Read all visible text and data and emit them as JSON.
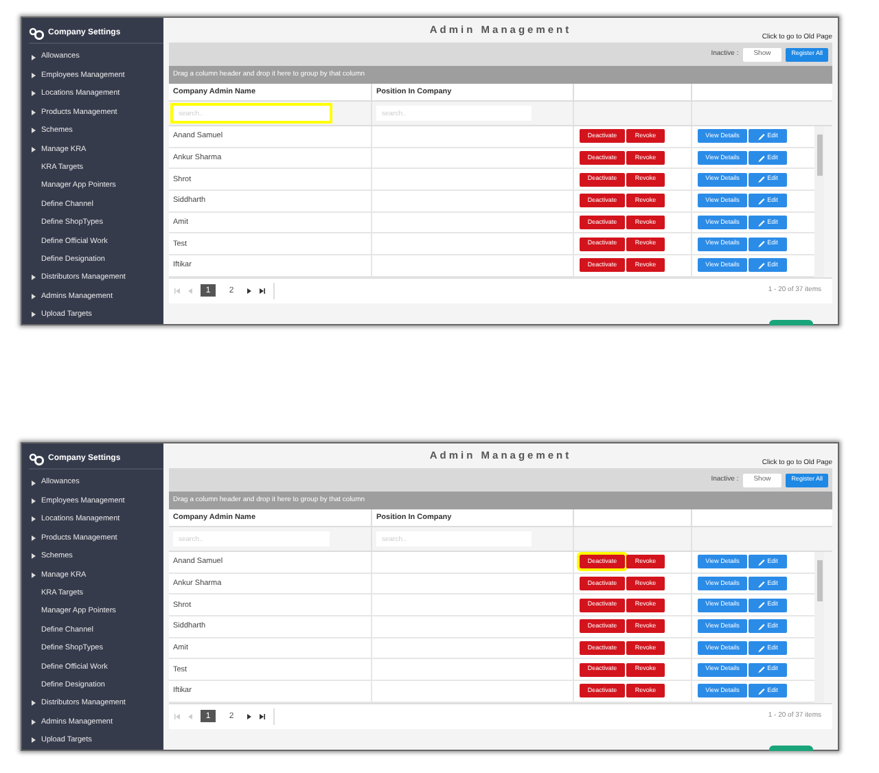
{
  "panels": [
    {
      "sidebar": {
        "title": "Company Settings",
        "items": [
          {
            "label": "Allowances",
            "arrow": true
          },
          {
            "label": "Employees Management",
            "arrow": true
          },
          {
            "label": "Locations Management",
            "arrow": true
          },
          {
            "label": "Products Management",
            "arrow": true
          },
          {
            "label": "Schemes",
            "arrow": true
          },
          {
            "label": "Manage KRA",
            "arrow": true
          },
          {
            "label": "KRA Targets",
            "arrow": false
          },
          {
            "label": "Manager App Pointers",
            "arrow": false
          },
          {
            "label": "Define Channel",
            "arrow": false
          },
          {
            "label": "Define ShopTypes",
            "arrow": false
          },
          {
            "label": "Define Official Work",
            "arrow": false
          },
          {
            "label": "Define Designation",
            "arrow": false
          },
          {
            "label": "Distributors Management",
            "arrow": true
          },
          {
            "label": "Admins Management",
            "arrow": true
          },
          {
            "label": "Upload Targets",
            "arrow": true
          }
        ]
      },
      "title": "Admin Management",
      "old_page_link": "Click to go to Old Page",
      "inactive_label": "Inactive :",
      "show_toggle": "Show",
      "register_all": "Register All",
      "group_hint": "Drag a column header and drop it here to group by that column",
      "columns": [
        {
          "title": "Company Admin Name",
          "placeholder": "search..",
          "highlighted": true
        },
        {
          "title": "Position In Company",
          "placeholder": "search..",
          "highlighted": false
        }
      ],
      "rows": [
        {
          "name": "Anand Samuel",
          "deactivate": "Deactivate",
          "revoke": "Revoke",
          "view": "View Details",
          "edit": "Edit",
          "highlighted": false
        },
        {
          "name": "Ankur Sharma",
          "deactivate": "Deactivate",
          "revoke": "Revoke",
          "view": "View Details",
          "edit": "Edit",
          "highlighted": false
        },
        {
          "name": "Shrot",
          "deactivate": "Deactivate",
          "revoke": "Revoke",
          "view": "View Details",
          "edit": "Edit",
          "highlighted": false
        },
        {
          "name": "Siddharth",
          "deactivate": "Deactivate",
          "revoke": "Revoke",
          "view": "View Details",
          "edit": "Edit",
          "highlighted": false
        },
        {
          "name": "Amit",
          "deactivate": "Deactivate",
          "revoke": "Revoke",
          "view": "View Details",
          "edit": "Edit",
          "highlighted": false
        },
        {
          "name": "Test",
          "deactivate": "Deactivate",
          "revoke": "Revoke",
          "view": "View Details",
          "edit": "Edit",
          "highlighted": false
        },
        {
          "name": "Iftikar",
          "deactivate": "Deactivate",
          "revoke": "Revoke",
          "view": "View Details",
          "edit": "Edit",
          "highlighted": false
        }
      ],
      "pages": [
        {
          "label": "1",
          "selected": true
        },
        {
          "label": "2",
          "selected": false
        }
      ],
      "items_info": "1 - 20 of 37 items"
    },
    {
      "sidebar": {
        "title": "Company Settings",
        "items": [
          {
            "label": "Allowances",
            "arrow": true
          },
          {
            "label": "Employees Management",
            "arrow": true
          },
          {
            "label": "Locations Management",
            "arrow": true
          },
          {
            "label": "Products Management",
            "arrow": true
          },
          {
            "label": "Schemes",
            "arrow": true
          },
          {
            "label": "Manage KRA",
            "arrow": true
          },
          {
            "label": "KRA Targets",
            "arrow": false
          },
          {
            "label": "Manager App Pointers",
            "arrow": false
          },
          {
            "label": "Define Channel",
            "arrow": false
          },
          {
            "label": "Define ShopTypes",
            "arrow": false
          },
          {
            "label": "Define Official Work",
            "arrow": false
          },
          {
            "label": "Define Designation",
            "arrow": false
          },
          {
            "label": "Distributors Management",
            "arrow": true
          },
          {
            "label": "Admins Management",
            "arrow": true
          },
          {
            "label": "Upload Targets",
            "arrow": true
          }
        ]
      },
      "title": "Admin Management",
      "old_page_link": "Click to go to Old Page",
      "inactive_label": "Inactive :",
      "show_toggle": "Show",
      "register_all": "Register All",
      "group_hint": "Drag a column header and drop it here to group by that column",
      "columns": [
        {
          "title": "Company Admin Name",
          "placeholder": "search..",
          "highlighted": false
        },
        {
          "title": "Position In Company",
          "placeholder": "search..",
          "highlighted": false
        }
      ],
      "rows": [
        {
          "name": "Anand Samuel",
          "deactivate": "Deactivate",
          "revoke": "Revoke",
          "view": "View Details",
          "edit": "Edit",
          "highlighted": true
        },
        {
          "name": "Ankur Sharma",
          "deactivate": "Deactivate",
          "revoke": "Revoke",
          "view": "View Details",
          "edit": "Edit",
          "highlighted": false
        },
        {
          "name": "Shrot",
          "deactivate": "Deactivate",
          "revoke": "Revoke",
          "view": "View Details",
          "edit": "Edit",
          "highlighted": false
        },
        {
          "name": "Siddharth",
          "deactivate": "Deactivate",
          "revoke": "Revoke",
          "view": "View Details",
          "edit": "Edit",
          "highlighted": false
        },
        {
          "name": "Amit",
          "deactivate": "Deactivate",
          "revoke": "Revoke",
          "view": "View Details",
          "edit": "Edit",
          "highlighted": false
        },
        {
          "name": "Test",
          "deactivate": "Deactivate",
          "revoke": "Revoke",
          "view": "View Details",
          "edit": "Edit",
          "highlighted": false
        },
        {
          "name": "Iftikar",
          "deactivate": "Deactivate",
          "revoke": "Revoke",
          "view": "View Details",
          "edit": "Edit",
          "highlighted": false
        }
      ],
      "pages": [
        {
          "label": "1",
          "selected": true
        },
        {
          "label": "2",
          "selected": false
        }
      ],
      "items_info": "1 - 20 of 37 items"
    }
  ]
}
